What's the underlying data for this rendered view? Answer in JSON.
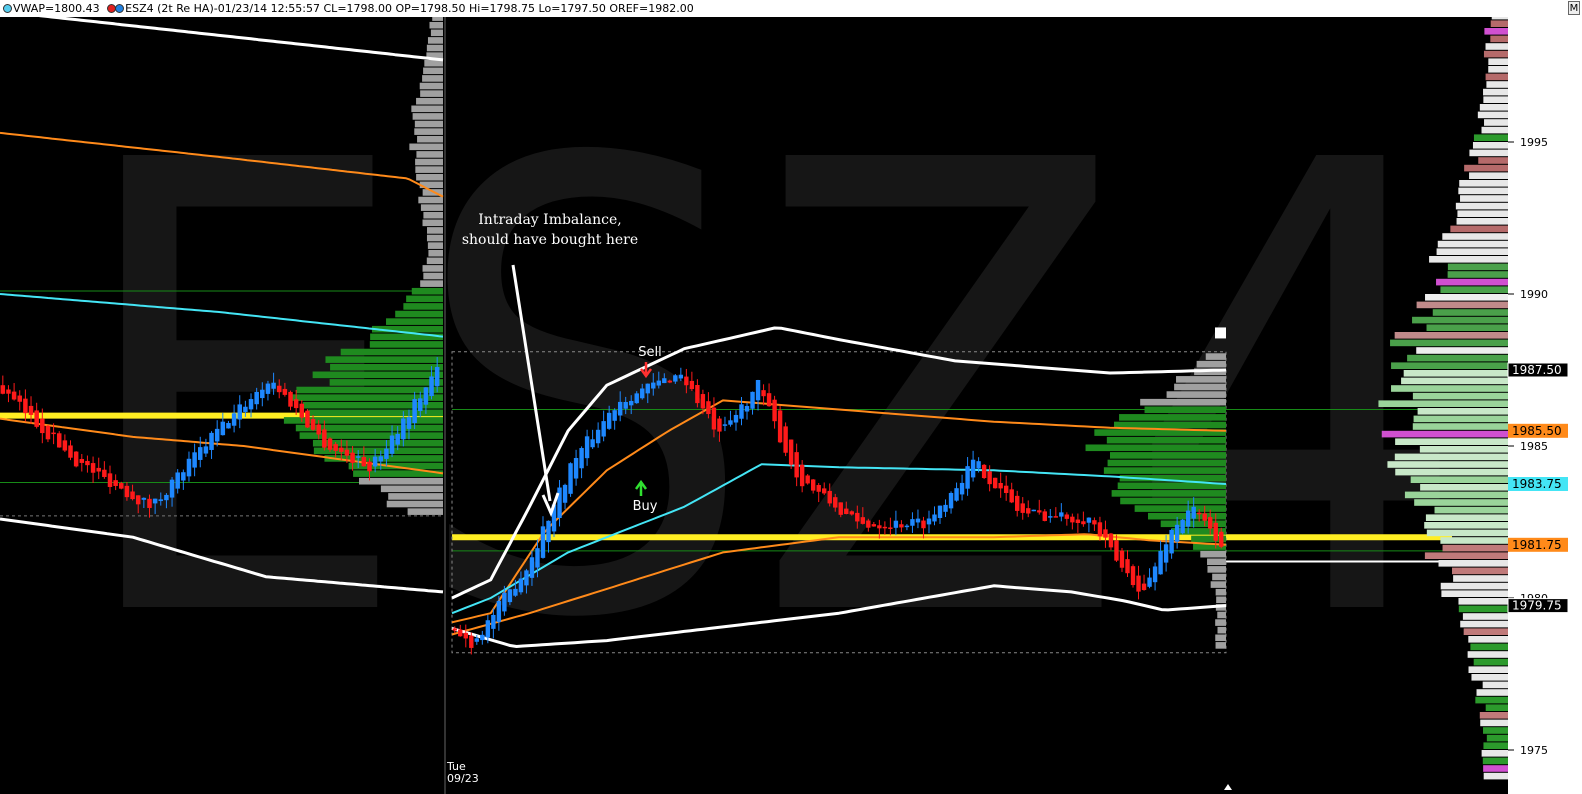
{
  "header": {
    "vwap_label": "VWAP=1800.43",
    "instrument_label": "ESZ4 (2t Re HA)-01/23/14 12:55:57 CL=1798.00 OP=1798.50 Hi=1798.75 Lo=1797.50 OREF=1982.00",
    "menu_button": "M",
    "vwap_dot_color": "#55ccee",
    "esz4_dot_colors": [
      "#e02020",
      "#2080e0"
    ]
  },
  "watermark": "ESZ4",
  "annotations": {
    "imbalance_line1": "Intraday Imbalance,",
    "imbalance_line2": "should have bought here",
    "sell": "Sell",
    "buy": "Buy"
  },
  "date_label": {
    "day": "Tue",
    "date": "09/23"
  },
  "colors": {
    "up_candle": "#1e88ff",
    "down_candle": "#ff1a1a",
    "vwap": "#44e5f5",
    "band_orange": "#ff8a1a",
    "band_white": "#ffffff",
    "poc": "#ffee22",
    "value_area": "#1f8a1f",
    "profile_gray": "#a0a0a0"
  },
  "chart_data": {
    "type": "candlestick",
    "ylim": [
      1974,
      2003
    ],
    "y_ticks": [
      1975,
      1980,
      1985,
      1990,
      1995
    ],
    "price_tags": [
      {
        "value": 1987.5,
        "label": "1987.50",
        "color": "#ffffff"
      },
      {
        "value": 1985.5,
        "label": "1985.50",
        "color": "#ff8a1a"
      },
      {
        "value": 1983.75,
        "label": "1983.75",
        "color": "#44e5f5"
      },
      {
        "value": 1981.75,
        "label": "1981.75",
        "color": "#ff8a1a"
      },
      {
        "value": 1979.75,
        "label": "1979.75",
        "color": "#ffffff"
      }
    ],
    "prev_session": {
      "poc": 1986.0,
      "vah": 1990.1,
      "val": 1983.8,
      "candle_price_path": [
        [
          0,
          1987.0
        ],
        [
          0.18,
          1984.5
        ],
        [
          0.35,
          1983.0
        ],
        [
          0.5,
          1985.5
        ],
        [
          0.62,
          1987.2
        ],
        [
          0.75,
          1985.0
        ],
        [
          0.85,
          1984.3
        ],
        [
          1,
          1987.5
        ]
      ],
      "bands": {
        "upper_white": [
          [
            0,
            1999.3
          ],
          [
            0.5,
            1998.5
          ],
          [
            1,
            1997.7
          ]
        ],
        "upper_orange": [
          [
            0,
            1995.3
          ],
          [
            0.5,
            1994.5
          ],
          [
            0.92,
            1993.8
          ],
          [
            1,
            1993.2
          ]
        ],
        "vwap": [
          [
            0,
            1990.0
          ],
          [
            0.5,
            1989.4
          ],
          [
            1,
            1988.6
          ]
        ],
        "mid_orange": [
          [
            0,
            1985.9
          ],
          [
            0.3,
            1985.3
          ],
          [
            0.55,
            1985.0
          ],
          [
            1,
            1984.1
          ]
        ],
        "lower_white": [
          [
            0,
            1982.6
          ],
          [
            0.3,
            1982.0
          ],
          [
            0.6,
            1980.7
          ],
          [
            1,
            1980.2
          ]
        ]
      }
    },
    "current_session": {
      "poc": 1982.0,
      "vah": 1986.2,
      "val": 1981.55,
      "candle_price_path": [
        [
          0,
          1979.0
        ],
        [
          0.03,
          1978.5
        ],
        [
          0.1,
          1981.0
        ],
        [
          0.16,
          1984.5
        ],
        [
          0.22,
          1986.5
        ],
        [
          0.3,
          1987.4
        ],
        [
          0.35,
          1985.3
        ],
        [
          0.4,
          1987.0
        ],
        [
          0.45,
          1984.0
        ],
        [
          0.53,
          1982.4
        ],
        [
          0.62,
          1982.5
        ],
        [
          0.68,
          1984.5
        ],
        [
          0.74,
          1982.8
        ],
        [
          0.83,
          1982.6
        ],
        [
          0.87,
          1981.0
        ],
        [
          0.9,
          1980.2
        ],
        [
          0.93,
          1982.0
        ],
        [
          0.96,
          1983.0
        ],
        [
          1,
          1981.8
        ]
      ],
      "bands": {
        "upper_white": [
          [
            0,
            1980.0
          ],
          [
            0.05,
            1980.6
          ],
          [
            0.1,
            1983.0
          ],
          [
            0.15,
            1985.5
          ],
          [
            0.2,
            1987.0
          ],
          [
            0.3,
            1988.2
          ],
          [
            0.42,
            1988.9
          ],
          [
            0.5,
            1988.5
          ],
          [
            0.65,
            1987.8
          ],
          [
            0.85,
            1987.4
          ],
          [
            1,
            1987.5
          ]
        ],
        "upper_orange": [
          [
            0,
            1979.2
          ],
          [
            0.05,
            1979.5
          ],
          [
            0.12,
            1982.2
          ],
          [
            0.2,
            1984.2
          ],
          [
            0.28,
            1985.5
          ],
          [
            0.35,
            1986.5
          ],
          [
            0.5,
            1986.2
          ],
          [
            0.7,
            1985.8
          ],
          [
            0.85,
            1985.6
          ],
          [
            1,
            1985.5
          ]
        ],
        "vwap": [
          [
            0,
            1979.5
          ],
          [
            0.05,
            1980.0
          ],
          [
            0.15,
            1981.5
          ],
          [
            0.3,
            1983.0
          ],
          [
            0.4,
            1984.4
          ],
          [
            0.5,
            1984.3
          ],
          [
            0.7,
            1984.2
          ],
          [
            0.85,
            1984.0
          ],
          [
            1,
            1983.75
          ]
        ],
        "mid_orange": [
          [
            0,
            1978.8
          ],
          [
            0.1,
            1979.5
          ],
          [
            0.2,
            1980.3
          ],
          [
            0.35,
            1981.5
          ],
          [
            0.5,
            1982.0
          ],
          [
            0.7,
            1982.0
          ],
          [
            0.82,
            1982.1
          ],
          [
            0.9,
            1981.9
          ],
          [
            1,
            1981.75
          ]
        ],
        "lower_white": [
          [
            0,
            1979.0
          ],
          [
            0.08,
            1978.4
          ],
          [
            0.2,
            1978.6
          ],
          [
            0.3,
            1978.9
          ],
          [
            0.5,
            1979.5
          ],
          [
            0.7,
            1980.4
          ],
          [
            0.8,
            1980.2
          ],
          [
            0.87,
            1979.9
          ],
          [
            0.92,
            1979.6
          ],
          [
            1,
            1979.75
          ]
        ]
      }
    }
  }
}
